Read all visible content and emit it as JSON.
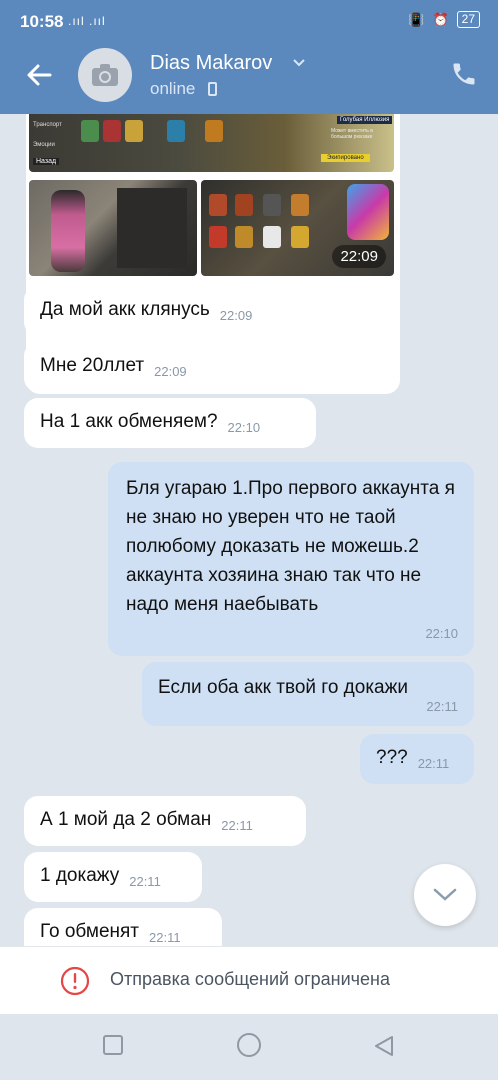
{
  "status_bar": {
    "time": "10:58",
    "signal": ".ııl .ııl",
    "battery": "27"
  },
  "header": {
    "contact_name": "Dias Makarov",
    "status": "online"
  },
  "media": {
    "menu_items": [
      "Транспорт",
      "Эмоции"
    ],
    "back_label": "Назад",
    "panel_label": "Голубая Иллюзия",
    "panel_sub": "Может вместить в большом рюкзаке",
    "action_label": "Экипировано",
    "time": "22:09"
  },
  "messages": [
    {
      "side": "in",
      "text": "Да мой акк клянусь",
      "time": "22:09"
    },
    {
      "side": "in",
      "text": "Мне 20ллет",
      "time": "22:09"
    },
    {
      "side": "in",
      "text": "На 1 акк обменяем?",
      "time": "22:10"
    },
    {
      "side": "out",
      "text": "Бля угараю 1.Про первого аккаунта я не знаю но уверен что не таой полюбому доказать не можешь.2 аккаунта хозяина знаю так что не надо меня наебывать",
      "time": "22:10"
    },
    {
      "side": "out",
      "text": "Если оба акк твой го докажи",
      "time": "22:11"
    },
    {
      "side": "out",
      "text": "???",
      "time": "22:11"
    },
    {
      "side": "in",
      "text": "А 1 мой да 2 обман",
      "time": "22:11"
    },
    {
      "side": "in",
      "text": "1 докажу",
      "time": "22:11"
    },
    {
      "side": "in",
      "text": "Го обменят",
      "time": "22:11"
    }
  ],
  "restricted_text": "Отправка сообщений ограничена",
  "colors": {
    "header": "#5b88bd",
    "incoming": "#ffffff",
    "outgoing": "#cfe0f4",
    "warning": "#e64646"
  }
}
